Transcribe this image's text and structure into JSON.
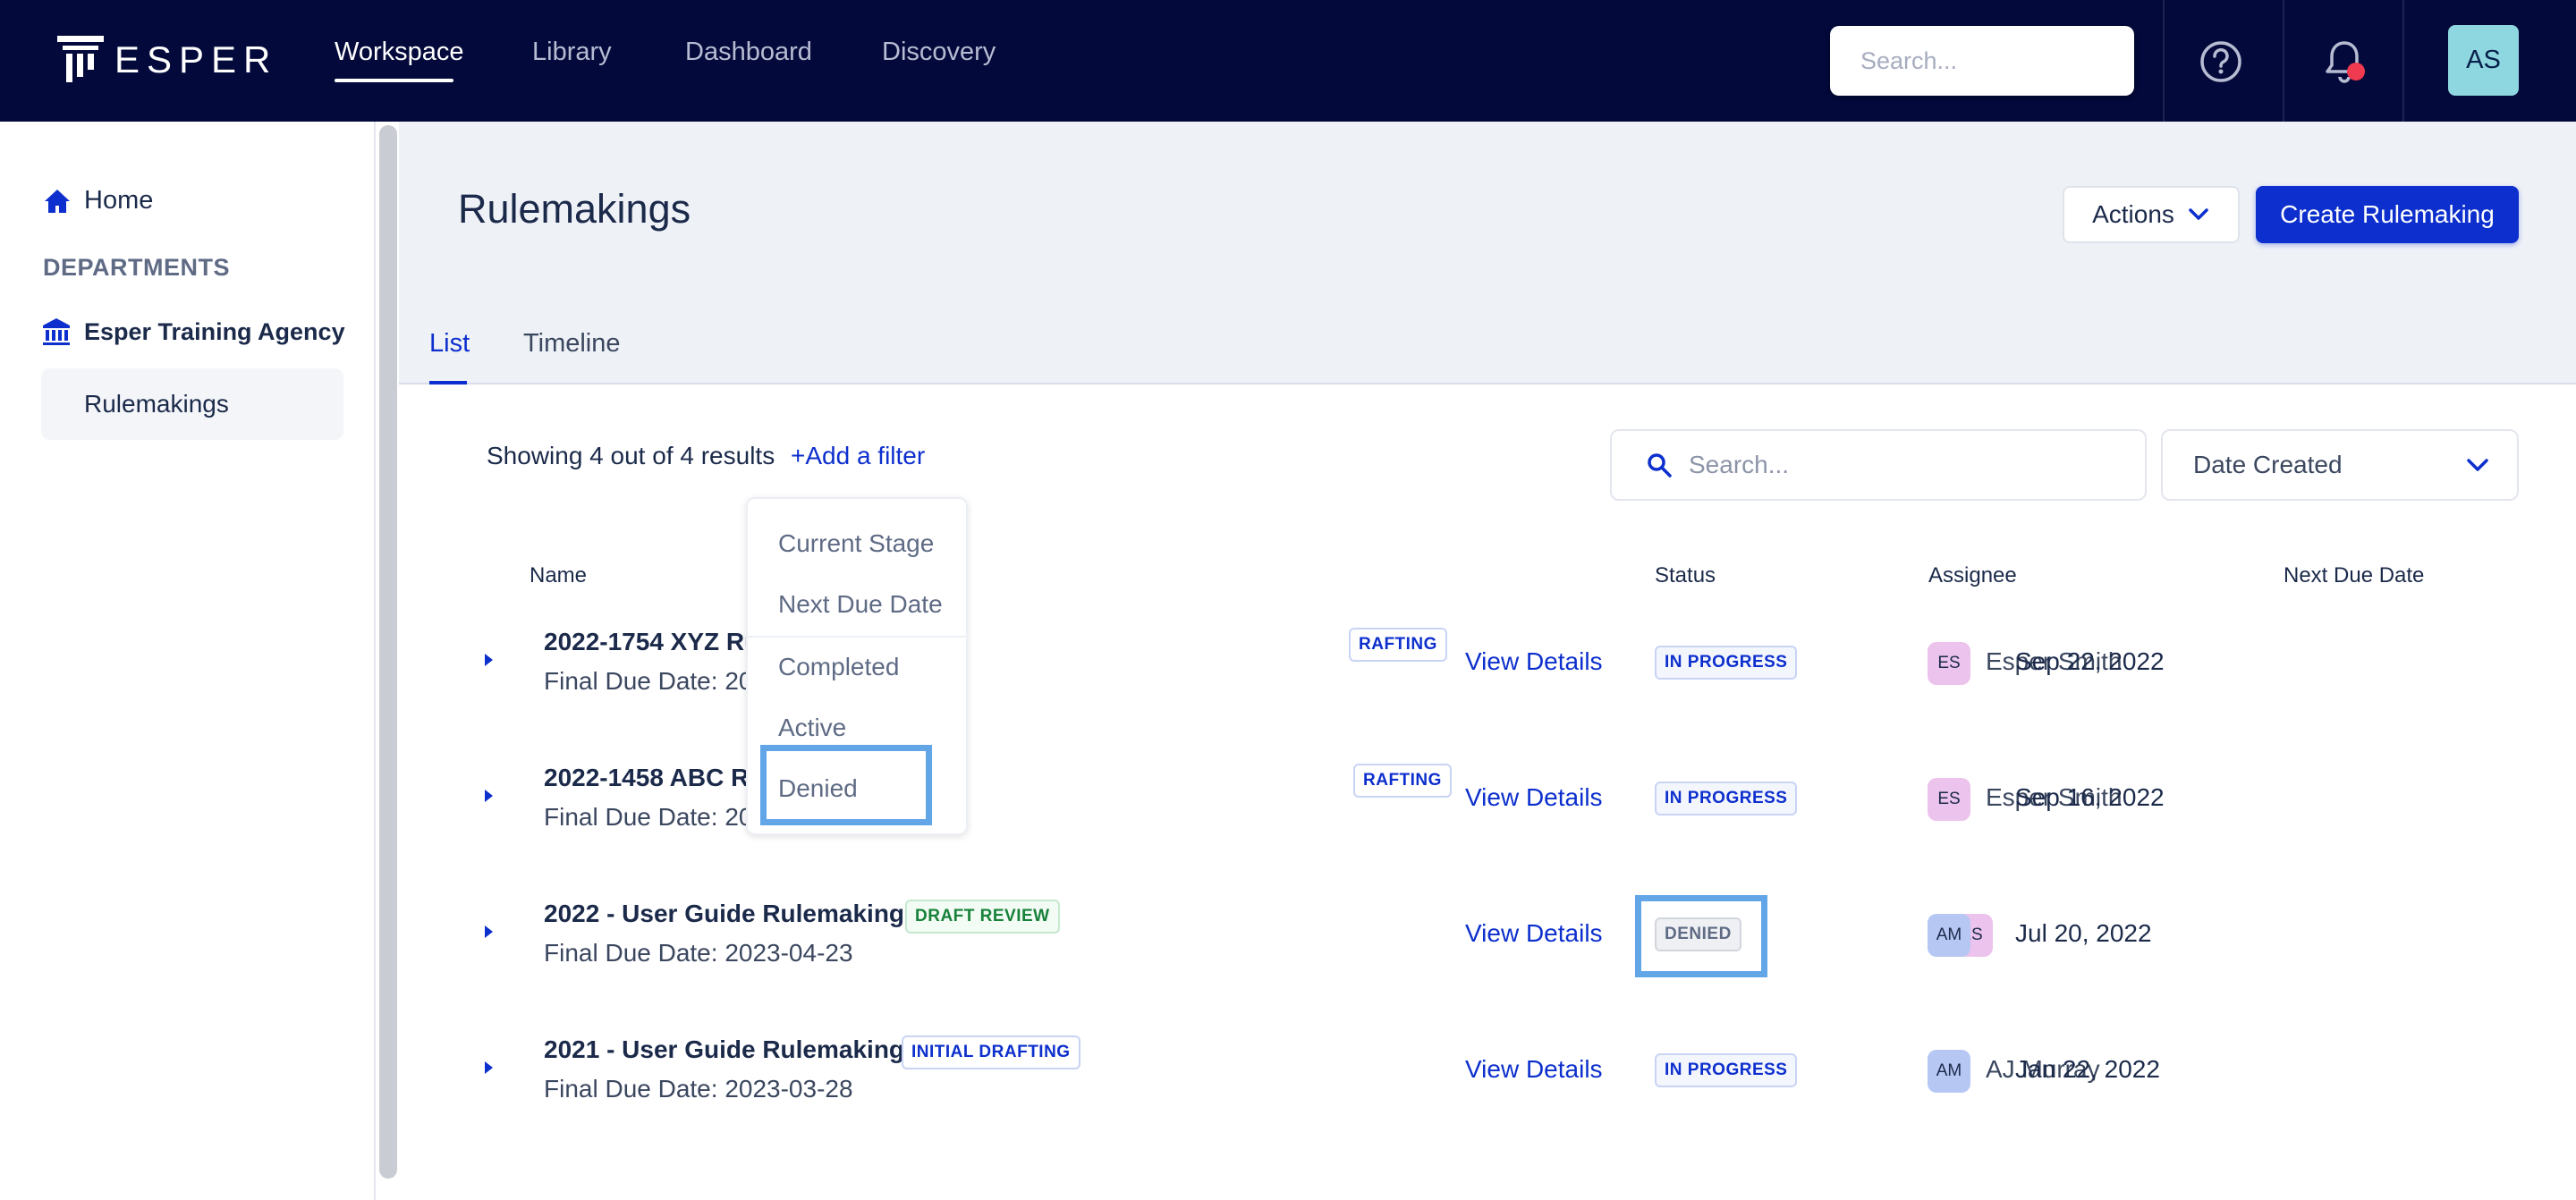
{
  "nav": {
    "logo_text": "ESPER",
    "links": [
      "Workspace",
      "Library",
      "Dashboard",
      "Discovery"
    ],
    "active_link": "Workspace",
    "search_placeholder": "Search...",
    "user_initials": "AS"
  },
  "sidebar": {
    "home_label": "Home",
    "section_heading": "DEPARTMENTS",
    "agency_label": "Esper Training Agency",
    "items": [
      {
        "label": "Rulemakings",
        "selected": true
      }
    ]
  },
  "header": {
    "title": "Rulemakings",
    "actions_label": "Actions",
    "create_label": "Create Rulemaking"
  },
  "tabs": [
    {
      "label": "List",
      "active": true
    },
    {
      "label": "Timeline",
      "active": false
    }
  ],
  "toolbar": {
    "results_text": "Showing 4 out of 4 results",
    "add_filter_label": "+Add a filter",
    "search_placeholder": "Search...",
    "sort_value": "Date Created"
  },
  "filter_menu": {
    "items": [
      "Current Stage",
      "Next Due Date",
      "Completed",
      "Active",
      "Denied"
    ],
    "highlighted": "Denied"
  },
  "table": {
    "columns": {
      "name": "Name",
      "status": "Status",
      "assignee": "Assignee",
      "next_due": "Next Due Date"
    },
    "view_details_label": "View Details",
    "rows": [
      {
        "name": "2022-1754 XYZ Ru",
        "stage": "RAFTING",
        "final_due": "Final Due Date: 20",
        "status": "IN PROGRESS",
        "assignee_initials": [
          "ES"
        ],
        "assignee_name": "Esper Smith",
        "next_due": "Sep 22, 2022"
      },
      {
        "name": "2022-1458 ABC Ru",
        "stage": "RAFTING",
        "final_due": "Final Due Date: 20",
        "status": "IN PROGRESS",
        "assignee_initials": [
          "ES"
        ],
        "assignee_name": "Esper Smith",
        "next_due": "Sep 16, 2022"
      },
      {
        "name": "2022 - User Guide Rulemaking",
        "stage": "DRAFT REVIEW",
        "final_due": "Final Due Date: 2023-04-23",
        "status": "DENIED",
        "assignee_initials": [
          "AM",
          "ES"
        ],
        "assignee_name": "",
        "next_due": "Jul 20, 2022"
      },
      {
        "name": "2021 - User Guide Rulemaking",
        "stage": "INITIAL DRAFTING",
        "final_due": "Final Due Date: 2023-03-28",
        "status": "IN PROGRESS",
        "assignee_initials": [
          "AM"
        ],
        "assignee_name": "AJ Murray",
        "next_due": "Jan 22, 2022"
      }
    ]
  },
  "colors": {
    "nav_bg": "#03093a",
    "accent": "#0c2fcd",
    "highlight": "#62a6e8",
    "notification": "#f03a4f"
  }
}
